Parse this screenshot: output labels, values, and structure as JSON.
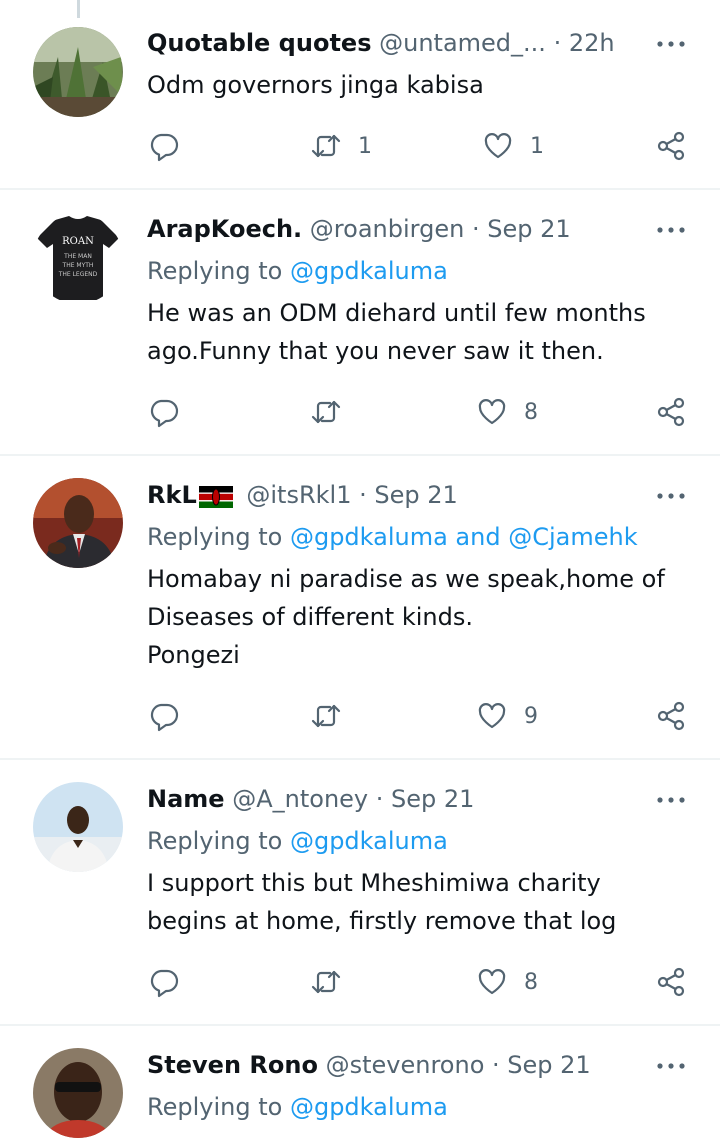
{
  "colors": {
    "accent": "#1d9bf0",
    "muted": "#536471",
    "text": "#0f1419",
    "divider": "#eff3f4"
  },
  "tweets": [
    {
      "name": "Quotable quotes",
      "handle": "@untamed_...",
      "sep": "·",
      "time": "22h",
      "replying_prefix": "",
      "replying_to": "",
      "text": "Odm governors jinga kabisa",
      "stats": {
        "reply": "",
        "retweet": "1",
        "like": "1"
      }
    },
    {
      "name": "ArapKoech.",
      "handle": "@roanbirgen",
      "sep": "·",
      "time": "Sep 21",
      "replying_prefix": "Replying to",
      "replying_to": "@gpdkaluma",
      "text": "He was an ODM diehard until few months\nago.Funny that you never saw it then.",
      "stats": {
        "reply": "",
        "retweet": "",
        "like": "8"
      }
    },
    {
      "name": "RkL",
      "handle": "@itsRkl1",
      "sep": "·",
      "time": "Sep 21",
      "replying_prefix": "Replying to",
      "replying_to": "@gpdkaluma and @Cjamehk",
      "text": "Homabay ni paradise as we speak,home of\nDiseases of different kinds.\nPongezi",
      "stats": {
        "reply": "",
        "retweet": "",
        "like": "9"
      }
    },
    {
      "name": "Name",
      "handle": "@A_ntoney",
      "sep": "·",
      "time": "Sep 21",
      "replying_prefix": "Replying to",
      "replying_to": "@gpdkaluma",
      "text": "I support this but Mheshimiwa charity\nbegins at home,  firstly remove that log",
      "stats": {
        "reply": "",
        "retweet": "",
        "like": "8"
      }
    },
    {
      "name": "Steven Rono",
      "handle": "@stevenrono",
      "sep": "·",
      "time": "Sep 21",
      "replying_prefix": "Replying to",
      "replying_to": "@gpdkaluma",
      "text": "",
      "stats": {
        "reply": "",
        "retweet": "",
        "like": ""
      }
    }
  ],
  "avatar_shirt_text": [
    "ROAN",
    "THE MAN",
    "THE MYTH",
    "THE LEGEND"
  ],
  "icons": {
    "reply": "reply-icon",
    "retweet": "retweet-icon",
    "like": "heart-icon",
    "share": "share-icon",
    "more": "more-icon",
    "flag": "kenya-flag-icon"
  }
}
